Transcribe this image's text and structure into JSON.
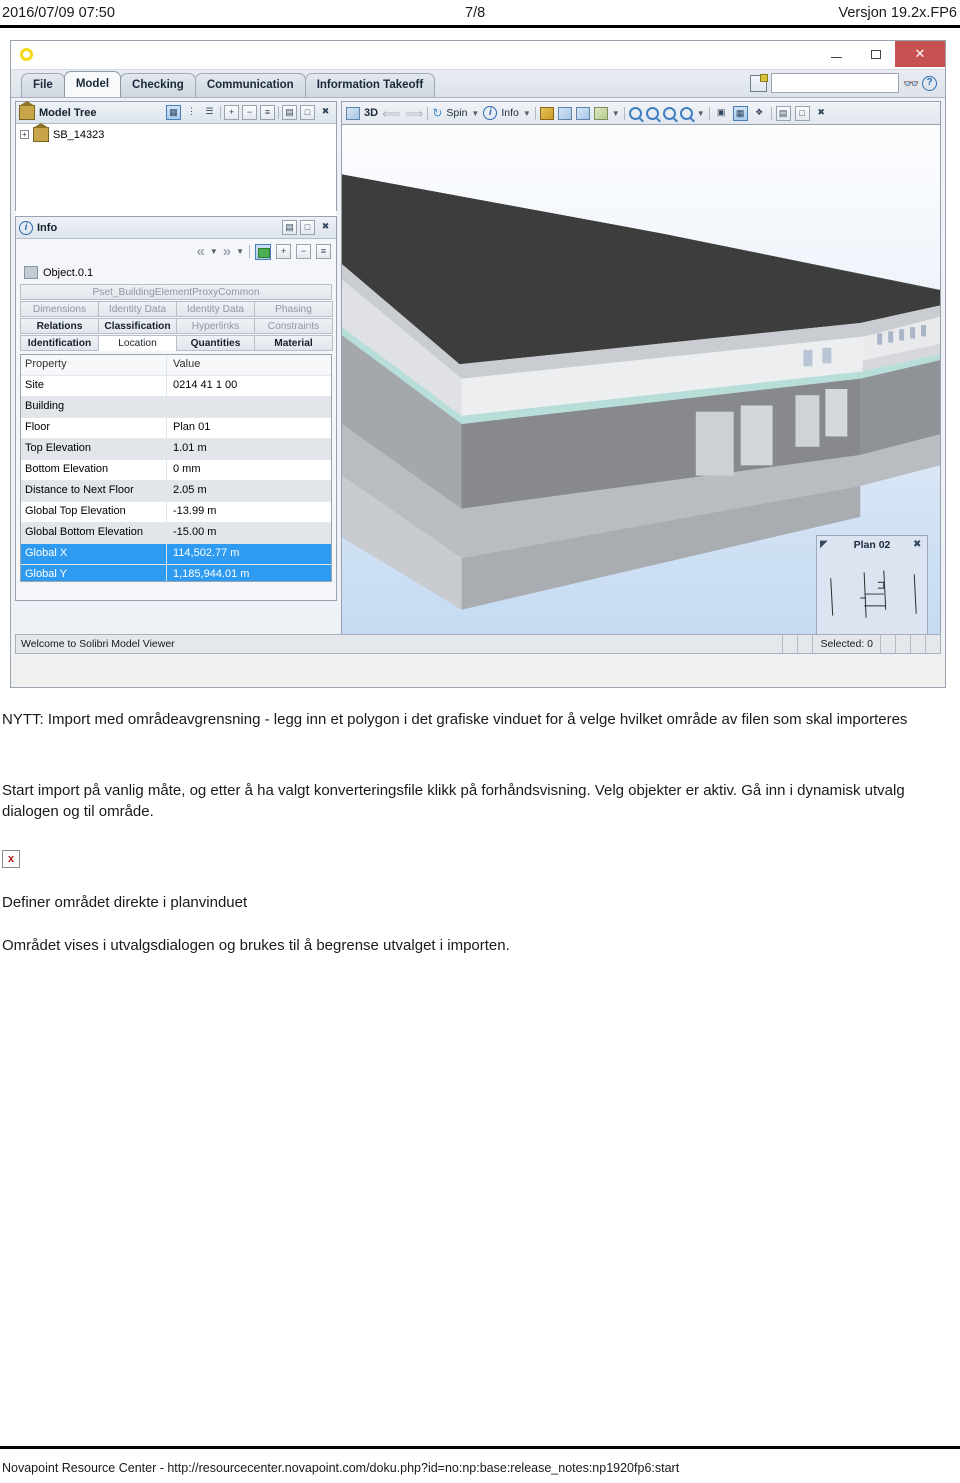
{
  "page_header": {
    "timestamp": "2016/07/09 07:50",
    "page_number": "7/8",
    "version": "Versjon 19.2x.FP6"
  },
  "app": {
    "titlebar": {
      "logo": "solibri-ring-logo",
      "minimize": "_",
      "maximize": "□",
      "close": "✕"
    },
    "ribbon": {
      "tabs": [
        {
          "label": "File",
          "active": false
        },
        {
          "label": "Model",
          "active": true
        },
        {
          "label": "Checking",
          "active": false
        },
        {
          "label": "Communication",
          "active": false
        },
        {
          "label": "Information Takeoff",
          "active": false
        }
      ],
      "search_value": "",
      "search_placeholder": "",
      "find_icon": "binoculars-icon",
      "help_icon": "help-icon"
    },
    "model_tree": {
      "title": "Model Tree",
      "root_node": "SB_14323",
      "expand_glyph": "+",
      "toolbar_icons": [
        "tree-link-icon",
        "tree-branch-icon",
        "tree-layers-icon",
        "expand-all-icon",
        "collapse-all-icon",
        "list-icon",
        "restore-icon",
        "maximize-icon",
        "close-icon"
      ]
    },
    "info_panel": {
      "title": "Info",
      "object_name": "Object.0.1",
      "nav_icons": [
        "prev-icon",
        "prev-dropdown-icon",
        "next-icon",
        "next-dropdown-icon",
        "link-green-icon",
        "add-icon",
        "remove-icon",
        "list-icon"
      ],
      "header_icons": [
        "restore-icon",
        "maximize-icon",
        "close-icon"
      ],
      "pset_tab_rows": [
        [
          {
            "label": "Pset_BuildingElementProxyCommon",
            "state": "muted"
          }
        ],
        [
          {
            "label": "Dimensions",
            "state": "muted"
          },
          {
            "label": "Identity Data",
            "state": "muted"
          },
          {
            "label": "Identity Data",
            "state": "muted"
          },
          {
            "label": "Phasing",
            "state": "muted"
          }
        ],
        [
          {
            "label": "Relations",
            "state": "dark"
          },
          {
            "label": "Classification",
            "state": "dark"
          },
          {
            "label": "Hyperlinks",
            "state": "muted"
          },
          {
            "label": "Constraints",
            "state": "muted"
          }
        ],
        [
          {
            "label": "Identification",
            "state": "dark"
          },
          {
            "label": "Location",
            "state": "active"
          },
          {
            "label": "Quantities",
            "state": "dark"
          },
          {
            "label": "Material",
            "state": "dark"
          }
        ]
      ],
      "property_table": {
        "columns": [
          "Property",
          "Value"
        ],
        "rows": [
          {
            "property": "Site",
            "value": "0214 41 1 00",
            "selected": false
          },
          {
            "property": "Building",
            "value": "",
            "selected": false
          },
          {
            "property": "Floor",
            "value": "Plan 01",
            "selected": false
          },
          {
            "property": "Top Elevation",
            "value": "1.01 m",
            "selected": false
          },
          {
            "property": "Bottom Elevation",
            "value": "0 mm",
            "selected": false
          },
          {
            "property": "Distance to Next Floor",
            "value": "2.05 m",
            "selected": false
          },
          {
            "property": "Global Top Elevation",
            "value": "-13.99 m",
            "selected": false
          },
          {
            "property": "Global Bottom Elevation",
            "value": "-15.00 m",
            "selected": false
          },
          {
            "property": "Global X",
            "value": "114,502.77 m",
            "selected": true
          },
          {
            "property": "Global Y",
            "value": "1,185,944.01 m",
            "selected": true
          }
        ]
      }
    },
    "view_toolbar": {
      "view_label": "3D",
      "spin_label": "Spin",
      "info_label": "Info",
      "icons": [
        "view-3d-icon",
        "undo-icon",
        "redo-icon",
        "spin-icon",
        "info-icon",
        "solid-cube-icon",
        "transparent-cube-icon",
        "wireframe-cube-icon",
        "shaded-cube-icon",
        "view-dropdown-icon",
        "zoom-fit-icon",
        "zoom-in-icon",
        "zoom-out-icon",
        "zoom-area-icon",
        "zoom-dropdown-icon",
        "clip-icon",
        "plan-view-icon",
        "layers-icon",
        "restore-icon",
        "maximize-icon",
        "close-icon"
      ]
    },
    "mini_plan": {
      "title": "Plan 02",
      "pin_icon": "pin-icon",
      "close_icon": "close-icon",
      "cursor_icon": "hand-cursor-icon"
    },
    "statusbar": {
      "message": "Welcome to Solibri Model Viewer",
      "selected_label": "Selected: 0"
    }
  },
  "document": {
    "paragraph_1": "NYTT: Import med områdeavgrensning - legg inn et polygon i det grafiske vinduet for å velge hvilket område av filen som skal importeres",
    "paragraph_2": "Start import på vanlig måte, og etter å ha valgt konverteringsfile klikk på forhåndsvisning. Velg objekter er aktiv. Gå inn i dynamisk utvalg dialogen og til område.",
    "broken_image_glyph": "x",
    "paragraph_3": "Definer området direkte i planvinduet",
    "paragraph_4": "Området vises i utvalgsdialogen og brukes til å begrense utvalget i importen."
  },
  "page_footer": {
    "text": "Novapoint Resource Center - http://resourcecenter.novapoint.com/doku.php?id=no:np:base:release_notes:np1920fp6:start"
  }
}
